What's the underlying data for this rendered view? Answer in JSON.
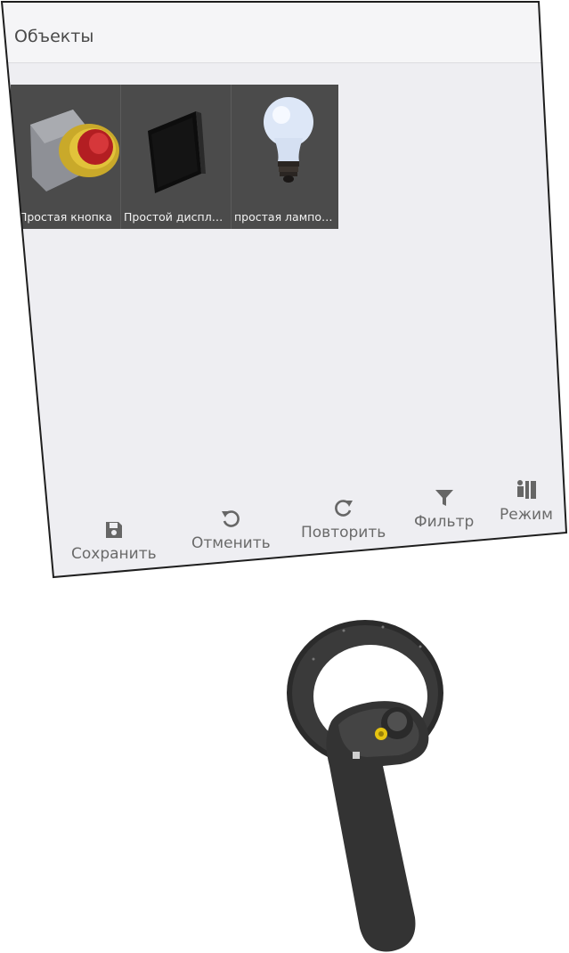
{
  "panel": {
    "title": "Объекты"
  },
  "objects": [
    {
      "label": "Простая кнопка",
      "icon": "red-button-icon"
    },
    {
      "label": "Простой диспле...",
      "icon": "display-icon"
    },
    {
      "label": "простая лампоч...",
      "icon": "lightbulb-icon"
    }
  ],
  "toolbar": {
    "save": "Сохранить",
    "undo": "Отменить",
    "redo": "Повторить",
    "filter": "Фильтр",
    "mode": "Режим"
  }
}
